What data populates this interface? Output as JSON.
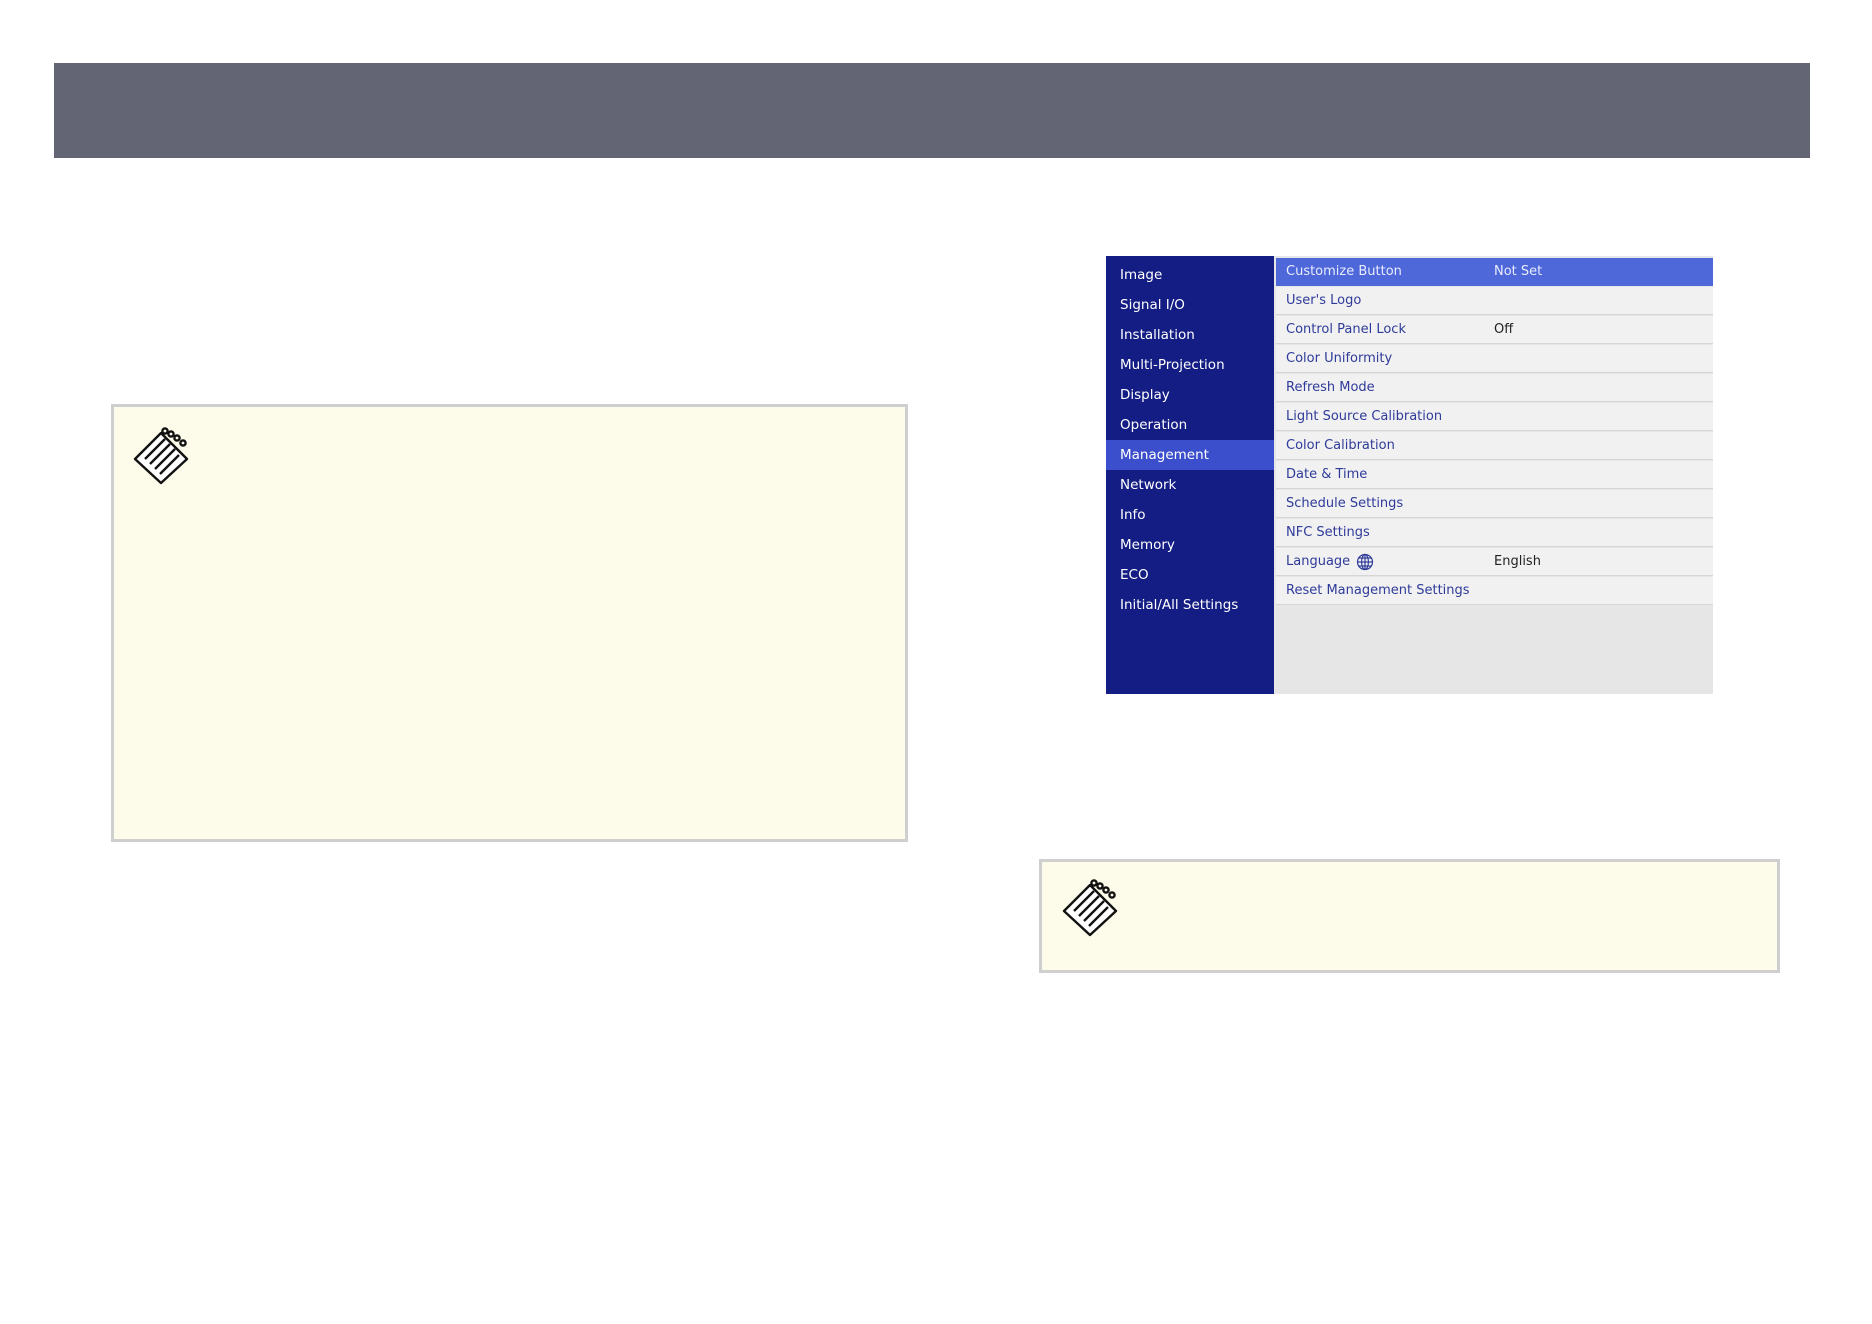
{
  "menu": {
    "sidebar": [
      {
        "label": "Image"
      },
      {
        "label": "Signal I/O"
      },
      {
        "label": "Installation"
      },
      {
        "label": "Multi-Projection"
      },
      {
        "label": "Display"
      },
      {
        "label": "Operation"
      },
      {
        "label": "Management"
      },
      {
        "label": "Network"
      },
      {
        "label": "Info"
      },
      {
        "label": "Memory"
      },
      {
        "label": "ECO"
      },
      {
        "label": "Initial/All Settings"
      }
    ],
    "active_sidebar": "Management",
    "items": [
      {
        "label": "Customize Button",
        "value": "Not Set"
      },
      {
        "label": "User's Logo",
        "value": ""
      },
      {
        "label": "Control Panel Lock",
        "value": "Off"
      },
      {
        "label": "Color Uniformity",
        "value": ""
      },
      {
        "label": "Refresh Mode",
        "value": ""
      },
      {
        "label": "Light Source Calibration",
        "value": ""
      },
      {
        "label": "Color Calibration",
        "value": ""
      },
      {
        "label": "Date & Time",
        "value": ""
      },
      {
        "label": "Schedule Settings",
        "value": ""
      },
      {
        "label": "NFC Settings",
        "value": ""
      },
      {
        "label": "Language",
        "value": "English"
      },
      {
        "label": "Reset Management Settings",
        "value": ""
      }
    ],
    "selected_item": "Customize Button"
  },
  "colors": {
    "header": "#636575",
    "sidebar": "#141d83",
    "sidebar_active": "#3b4fcc",
    "row_selected": "#4e67d9",
    "note_background": "#fdfbea"
  },
  "icons": {
    "note": "notepad-icon",
    "language": "globe-icon"
  }
}
